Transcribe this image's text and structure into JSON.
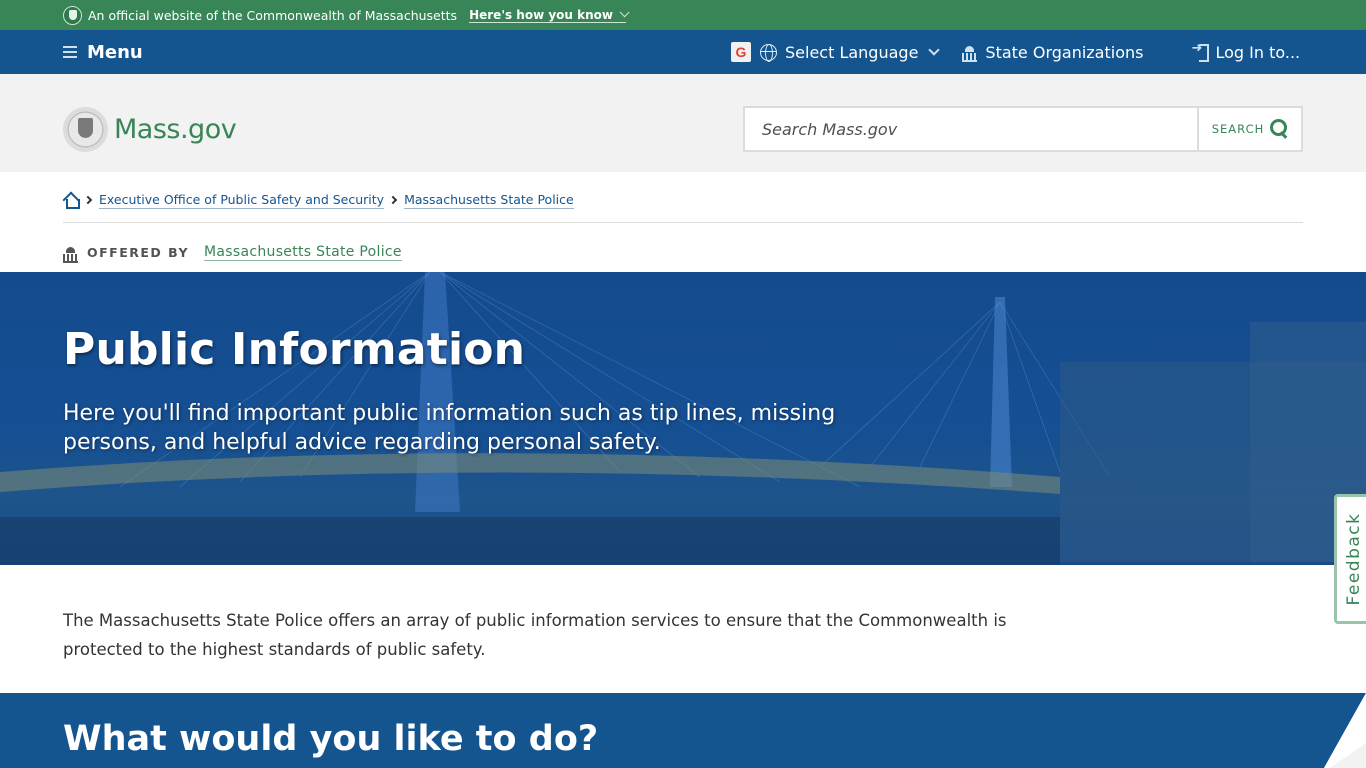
{
  "official_banner": {
    "text": "An official website of the Commonwealth of Massachusetts",
    "link": "Here's how you know"
  },
  "utility_nav": {
    "menu_label": "Menu",
    "language_label": "Select Language",
    "state_orgs_label": "State Organizations",
    "login_label": "Log In to..."
  },
  "header": {
    "logo_text": "Mass.gov",
    "search_placeholder": "Search Mass.gov",
    "search_button": "SEARCH"
  },
  "breadcrumb": {
    "items": [
      "Executive Office of Public Safety and Security",
      "Massachusetts State Police"
    ]
  },
  "offered_by": {
    "label": "OFFERED BY",
    "org": "Massachusetts State Police"
  },
  "hero": {
    "title": "Public Information",
    "subtitle": "Here you'll find important public information such as tip lines, missing persons, and helpful advice regarding personal safety."
  },
  "intro": {
    "text": "The Massachusetts State Police offers an array of public information services to ensure that the Commonwealth is protected to the highest standards of public safety."
  },
  "section": {
    "heading": "What would you like to do?"
  },
  "feedback": {
    "label": "Feedback"
  },
  "colors": {
    "brand_green": "#388557",
    "brand_blue": "#14558f",
    "header_gray": "#f2f2f2"
  }
}
